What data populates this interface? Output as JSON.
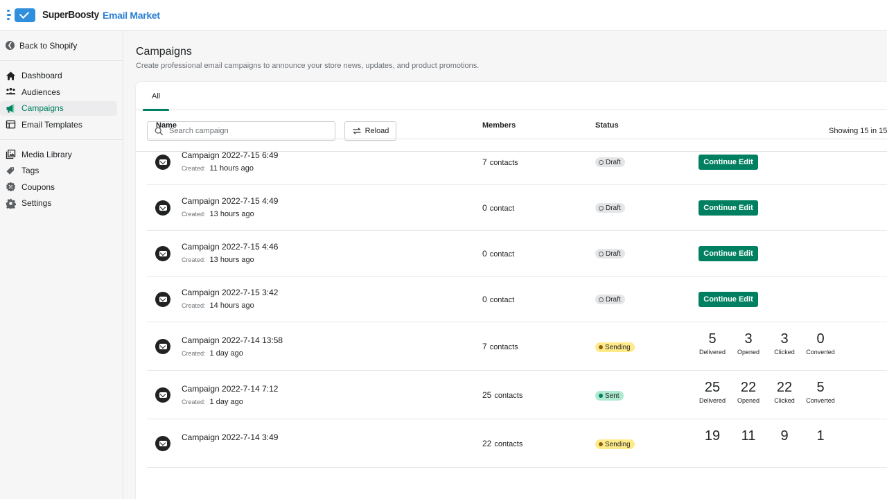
{
  "app": {
    "brand_primary": "SuperBoosty",
    "brand_secondary": "Email Market",
    "accent_color": "#008060"
  },
  "sidebar": {
    "back_label": "Back to Shopify",
    "groups": [
      [
        {
          "label": "Dashboard",
          "icon": "home-icon",
          "active": false
        },
        {
          "label": "Audiences",
          "icon": "people-icon",
          "active": false
        },
        {
          "label": "Campaigns",
          "icon": "megaphone-icon",
          "active": true
        },
        {
          "label": "Email Templates",
          "icon": "template-icon",
          "active": false
        }
      ],
      [
        {
          "label": "Media Library",
          "icon": "image-icon",
          "active": false
        },
        {
          "label": "Tags",
          "icon": "tag-icon",
          "active": false
        },
        {
          "label": "Coupons",
          "icon": "discount-icon",
          "active": false
        },
        {
          "label": "Settings",
          "icon": "gear-icon",
          "active": false
        }
      ]
    ]
  },
  "page": {
    "title": "Campaigns",
    "subtitle": "Create professional email campaigns to announce your store news, updates, and product promotions."
  },
  "tabs": [
    {
      "label": "All",
      "selected": true
    }
  ],
  "toolbar": {
    "search_placeholder": "Search campaign",
    "search_value": "",
    "reload_label": "Reload",
    "showing_text": "Showing 15 in 15"
  },
  "table": {
    "headers": {
      "name": "Name",
      "members": "Members",
      "status": "Status"
    },
    "created_label": "Created:",
    "continue_label": "Continue Edit",
    "stat_labels": [
      "Delivered",
      "Opened",
      "Clicked",
      "Converted"
    ],
    "rows": [
      {
        "name": "Campaign 2022-7-15 6:49",
        "created": "11 hours ago",
        "members_count": "7",
        "members_unit": "contacts",
        "status": "Draft"
      },
      {
        "name": "Campaign 2022-7-15 4:49",
        "created": "13 hours ago",
        "members_count": "0",
        "members_unit": "contact",
        "status": "Draft"
      },
      {
        "name": "Campaign 2022-7-15 4:46",
        "created": "13 hours ago",
        "members_count": "0",
        "members_unit": "contact",
        "status": "Draft"
      },
      {
        "name": "Campaign 2022-7-15 3:42",
        "created": "14 hours ago",
        "members_count": "0",
        "members_unit": "contact",
        "status": "Draft"
      },
      {
        "name": "Campaign 2022-7-14 13:58",
        "created": "1 day ago",
        "members_count": "7",
        "members_unit": "contacts",
        "status": "Sending",
        "stats": [
          "5",
          "3",
          "3",
          "0"
        ]
      },
      {
        "name": "Campaign 2022-7-14 7:12",
        "created": "1 day ago",
        "members_count": "25",
        "members_unit": "contacts",
        "status": "Sent",
        "stats": [
          "25",
          "22",
          "22",
          "5"
        ]
      },
      {
        "name": "Campaign 2022-7-14 3:49",
        "created": "",
        "members_count": "22",
        "members_unit": "contacts",
        "status": "Sending",
        "stats": [
          "19",
          "11",
          "9",
          "1"
        ]
      }
    ]
  }
}
